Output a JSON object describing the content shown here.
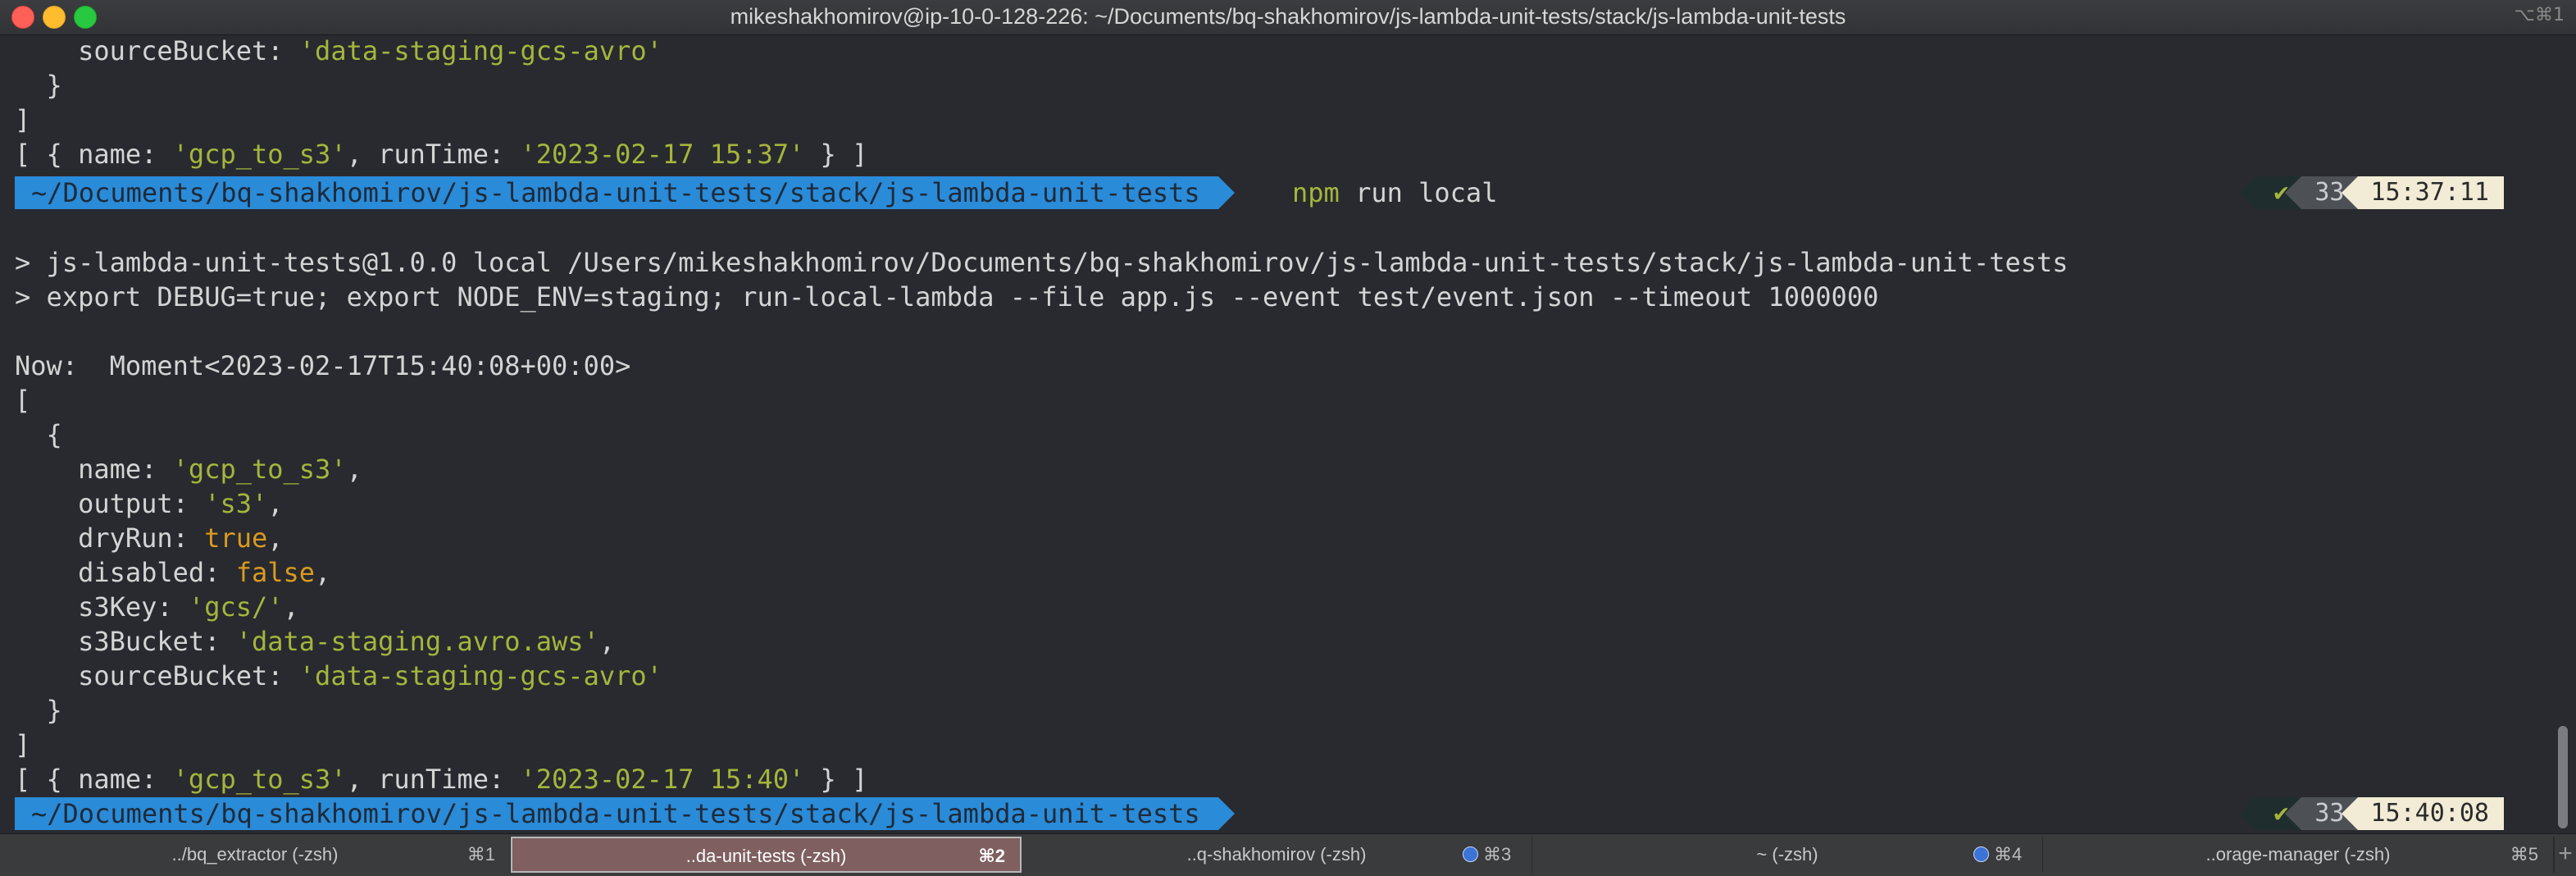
{
  "window": {
    "title": "mikeshakhomirov@ip-10-0-128-226: ~/Documents/bq-shakhomirov/js-lambda-unit-tests/stack/js-lambda-unit-tests",
    "title_shortcut": "⌥⌘1"
  },
  "terminal": {
    "prev_output": {
      "source_key": "sourceBucket",
      "source_value": "'data-staging-gcs-avro'",
      "close_brace": "}",
      "close_bracket": "]",
      "result": {
        "open": "[ { name: ",
        "name_value": "'gcp_to_s3'",
        "mid": ", runTime: ",
        "runtime_value": "'2023-02-17 15:37'",
        "close": " } ]"
      }
    },
    "prompt1": {
      "path": "~/Documents/bq-shakhomirov/js-lambda-unit-tests/stack/js-lambda-unit-tests",
      "cmd_npm": "npm",
      "cmd_rest": " run local",
      "status_icon": "✔",
      "history_count": "33",
      "time": "15:37:11"
    },
    "npm_lines": [
      "> js-lambda-unit-tests@1.0.0 local /Users/mikeshakhomirov/Documents/bq-shakhomirov/js-lambda-unit-tests/stack/js-lambda-unit-tests",
      "> export DEBUG=true; export NODE_ENV=staging; run-local-lambda --file app.js --event test/event.json --timeout 1000000"
    ],
    "now_line": "Now:  Moment<2023-02-17T15:40:08+00:00>",
    "array_open": "[",
    "object_open": "{",
    "fields": [
      {
        "key": "name",
        "value": "'gcp_to_s3'",
        "kind": "str",
        "comma": ","
      },
      {
        "key": "output",
        "value": "'s3'",
        "kind": "str",
        "comma": ","
      },
      {
        "key": "dryRun",
        "value": "true",
        "kind": "kw",
        "comma": ","
      },
      {
        "key": "disabled",
        "value": "false",
        "kind": "kw",
        "comma": ","
      },
      {
        "key": "s3Key",
        "value": "'gcs/'",
        "kind": "str",
        "comma": ","
      },
      {
        "key": "s3Bucket",
        "value": "'data-staging.avro.aws'",
        "kind": "str",
        "comma": ","
      },
      {
        "key": "sourceBucket",
        "value": "'data-staging-gcs-avro'",
        "kind": "str",
        "comma": ""
      }
    ],
    "object_close": "}",
    "array_close": "]",
    "result2": {
      "open": "[ { name: ",
      "name_value": "'gcp_to_s3'",
      "mid": ", runTime: ",
      "runtime_value": "'2023-02-17 15:40'",
      "close": " } ]"
    },
    "prompt2": {
      "path": "~/Documents/bq-shakhomirov/js-lambda-unit-tests/stack/js-lambda-unit-tests",
      "status_icon": "✔",
      "history_count": "33",
      "time": "15:40:08"
    }
  },
  "tabs": [
    {
      "label": "../bq_extractor (-zsh)",
      "shortcut": "⌘1",
      "active": false,
      "dot": false
    },
    {
      "label": "..da-unit-tests (-zsh)",
      "shortcut": "⌘2",
      "active": true,
      "dot": false
    },
    {
      "label": "..q-shakhomirov (-zsh)",
      "shortcut": "⌘3",
      "active": false,
      "dot": true
    },
    {
      "label": "~ (-zsh)",
      "shortcut": "⌘4",
      "active": false,
      "dot": true
    },
    {
      "label": "..orage-manager (-zsh)",
      "shortcut": "⌘5",
      "active": false,
      "dot": false
    }
  ],
  "new_tab_label": "+",
  "colors": {
    "background": "#282a2f",
    "string": "#a5b53c",
    "keyword": "#d99a1f",
    "prompt_path_bg": "#2a8bd8",
    "active_tab_bg": "#7f5f60",
    "time_bg": "#f2ecd6"
  }
}
